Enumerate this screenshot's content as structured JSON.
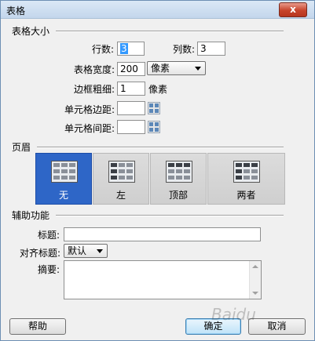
{
  "window": {
    "title": "表格",
    "close_glyph": "x"
  },
  "table_size": {
    "section_label": "表格大小",
    "rows_label": "行数:",
    "rows_value": "3",
    "cols_label": "列数:",
    "cols_value": "3",
    "width_label": "表格宽度:",
    "width_value": "200",
    "width_unit": "像素",
    "border_label": "边框粗细:",
    "border_value": "1",
    "border_unit": "像素",
    "padding_label": "单元格边距:",
    "padding_value": "",
    "spacing_label": "单元格间距:",
    "spacing_value": ""
  },
  "header": {
    "section_label": "页眉",
    "options": [
      {
        "label": "无",
        "selected": true
      },
      {
        "label": "左",
        "selected": false
      },
      {
        "label": "顶部",
        "selected": false
      },
      {
        "label": "两者",
        "selected": false
      }
    ]
  },
  "accessibility": {
    "section_label": "辅助功能",
    "caption_label": "标题:",
    "caption_value": "",
    "align_label": "对齐标题:",
    "align_value": "默认",
    "summary_label": "摘要:",
    "summary_value": ""
  },
  "buttons": {
    "help": "帮助",
    "ok": "确定",
    "cancel": "取消"
  },
  "watermark": "Baidu"
}
